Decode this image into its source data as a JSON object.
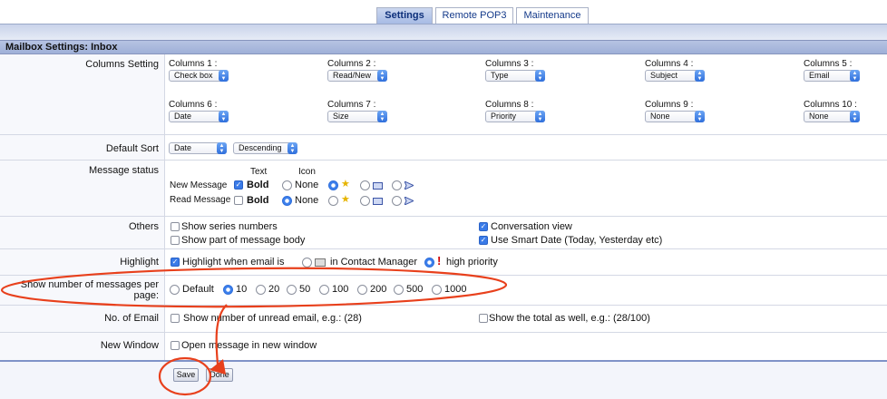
{
  "tabs": [
    {
      "label": "Settings",
      "active": true
    },
    {
      "label": "Remote POP3",
      "active": false
    },
    {
      "label": "Maintenance",
      "active": false
    }
  ],
  "section_title": "Mailbox Settings: Inbox",
  "columns_setting": {
    "label": "Columns Setting",
    "columns": [
      {
        "label": "Columns 1 :",
        "value": "Check box"
      },
      {
        "label": "Columns 2 :",
        "value": "Read/New"
      },
      {
        "label": "Columns 3 :",
        "value": "Type"
      },
      {
        "label": "Columns 4 :",
        "value": "Subject"
      },
      {
        "label": "Columns 5 :",
        "value": "Email"
      },
      {
        "label": "Columns 6 :",
        "value": "Date"
      },
      {
        "label": "Columns 7 :",
        "value": "Size"
      },
      {
        "label": "Columns 8 :",
        "value": "Priority"
      },
      {
        "label": "Columns 9 :",
        "value": "None"
      },
      {
        "label": "Columns 10 :",
        "value": "None"
      }
    ]
  },
  "default_sort": {
    "label": "Default Sort",
    "field": "Date",
    "order": "Descending"
  },
  "message_status": {
    "label": "Message status",
    "header_text": "Text",
    "header_icon": "Icon",
    "new_message": "New Message",
    "read_message": "Read Message",
    "bold": "Bold",
    "none": "None"
  },
  "others": {
    "label": "Others",
    "show_series": "Show series numbers",
    "show_part": "Show part of message body",
    "conversation": "Conversation view",
    "smart_date": "Use Smart Date (Today, Yesterday etc)"
  },
  "highlight": {
    "label": "Highlight",
    "when_email": "Highlight when email is",
    "contact_manager": "in Contact Manager",
    "high_priority": "high priority"
  },
  "messages_per_page": {
    "label_line1": "Show number of messages per",
    "label_line2": "page:",
    "options": [
      "Default",
      "10",
      "20",
      "50",
      "100",
      "200",
      "500",
      "1000"
    ],
    "selected": "10"
  },
  "no_of_email": {
    "label": "No. of Email",
    "show_unread": "Show number of unread email, e.g.: (28)",
    "show_total": "Show the total as well, e.g.: (28/100)"
  },
  "new_window": {
    "label": "New Window",
    "open_new": "Open message in new window"
  },
  "buttons": {
    "save": "Save",
    "done": "Done"
  },
  "colors": {
    "annotation": "#e8401c",
    "accent": "#3d80ec",
    "section_bar": "#a7b8de"
  }
}
